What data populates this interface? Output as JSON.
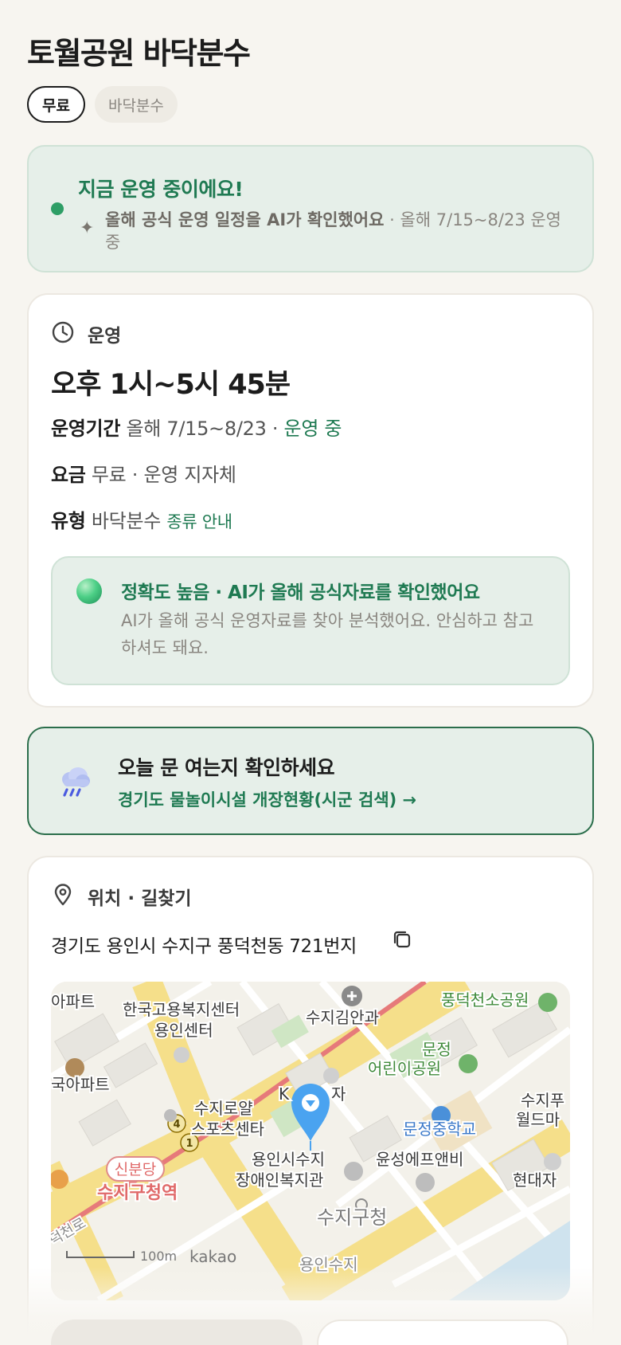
{
  "page": {
    "title": "토월공원 바닥분수",
    "chips": [
      "무료",
      "바닥분수"
    ]
  },
  "status": {
    "title": "지금 운영 중이에요!",
    "desc_strong": "올해 공식 운영 일정을 AI가 확인했어요",
    "desc_rest": " · 올해 7/15~8/23 운영 중"
  },
  "operation": {
    "section_label": "운영",
    "hours": "오후 1시~5시 45분",
    "period_key": "운영기간",
    "period_value": "올해 7/15~8/23 · ",
    "period_status": "운영 중",
    "fee_key": "요금",
    "fee_value": "무료 · 운영 지자체",
    "type_key": "유형",
    "type_value": "바닥분수",
    "type_link": "종류 안내",
    "accuracy_title": "정확도 높음 · AI가 올해 공식자료를 확인했어요",
    "accuracy_desc": "AI가 올해 공식 운영자료를 찾아 분석했어요. 안심하고 참고하셔도 돼요."
  },
  "check": {
    "title": "오늘 문 여는지 확인하세요",
    "link": "경기도 물놀이시설 개장현황(시군 검색) →"
  },
  "location": {
    "section_label": "위치 · 길찾기",
    "address": "경기도 용인시 수지구 풍덕천동 721번지",
    "map_labels": {
      "apartment_top": "아파트",
      "employment_center_1": "한국고용복지센터",
      "employment_center_2": "용인센터",
      "suji_kimanwa": "수지김안과",
      "pungdeokcheon_park": "풍덕천소공원",
      "munjeong_1": "문정",
      "munjeong_2": "어린이공원",
      "apartment_left": "국아파트",
      "k_plaza": "K",
      "plaza_suffix": "자",
      "suji_world_1": "수지푸",
      "suji_world_2": "월드마",
      "sports_1": "수지로얄",
      "sports_2": "스포츠센타",
      "munjeong_school": "문정중학교",
      "disabled_center_1": "용인시수지",
      "disabled_center_2": "장애인복지관",
      "yunseong": "윤성에프앤비",
      "hyundai": "현대자",
      "sinbundang": "신분당",
      "suji_station": "수지구청역",
      "suji_office": "수지구청",
      "cheonro": "덕천로",
      "scale": "100m",
      "kakao": "kakao",
      "yongin_suji_bottom": "용인수지",
      "line_4": "4",
      "line_1": "1"
    }
  }
}
